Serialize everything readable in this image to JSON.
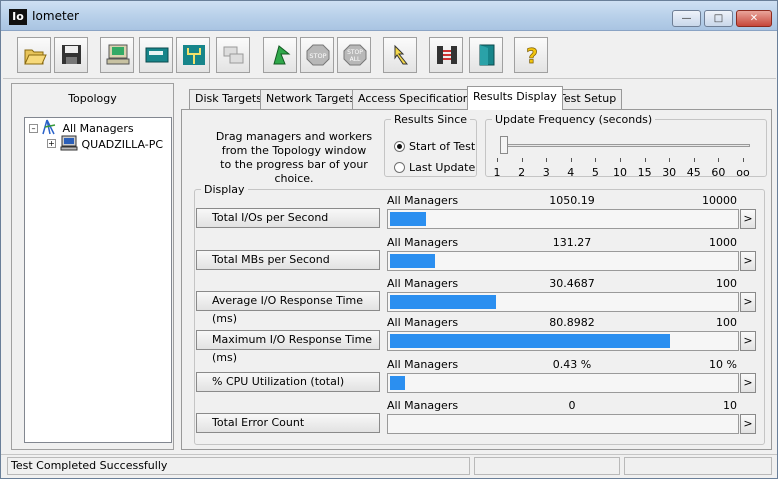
{
  "window": {
    "title": "Iometer",
    "app_icon_text": "Io"
  },
  "toolbar": {
    "buttons": [
      {
        "name": "open-config-icon"
      },
      {
        "name": "save-config-icon"
      },
      {
        "name": "new-manager-icon"
      },
      {
        "name": "new-disk-worker-icon"
      },
      {
        "name": "new-network-worker-icon"
      },
      {
        "name": "duplicate-worker-icon"
      },
      {
        "name": "start-tests-icon"
      },
      {
        "name": "stop-test-icon"
      },
      {
        "name": "stop-all-icon"
      },
      {
        "name": "reset-workers-icon"
      },
      {
        "name": "disconnect-workers-icon"
      },
      {
        "name": "exit-icon"
      },
      {
        "name": "about-icon"
      }
    ],
    "stop_label": "STOP",
    "stop_all_label": "STOP",
    "stop_all_sub": "ALL"
  },
  "topology": {
    "title": "Topology",
    "items": [
      {
        "label": "All Managers"
      },
      {
        "label": "QUADZILLA-PC"
      }
    ]
  },
  "tabs": [
    {
      "label": "Disk Targets",
      "active": false
    },
    {
      "label": "Network Targets",
      "active": false
    },
    {
      "label": "Access Specifications",
      "active": false
    },
    {
      "label": "Results Display",
      "active": true
    },
    {
      "label": "Test Setup",
      "active": false
    }
  ],
  "results": {
    "drag_text_1": "Drag managers and workers",
    "drag_text_2": "from the Topology window",
    "drag_text_3": "to the progress bar of your choice.",
    "since_title": "Results Since",
    "since_start": "Start of Test",
    "since_last": "Last Update",
    "since_selected": "start",
    "update_title": "Update Frequency (seconds)",
    "update_ticks": [
      "1",
      "2",
      "3",
      "4",
      "5",
      "10",
      "15",
      "30",
      "45",
      "60",
      "oo"
    ],
    "update_selected_index": 0,
    "display_title": "Display",
    "metrics": [
      {
        "button": "Total I/Os per Second",
        "source": "All Managers",
        "value": "1050.19",
        "max": "10000",
        "fraction": 0.105
      },
      {
        "button": "Total MBs per Second",
        "source": "All Managers",
        "value": "131.27",
        "max": "1000",
        "fraction": 0.131
      },
      {
        "button": "Average I/O Response Time (ms)",
        "source": "All Managers",
        "value": "30.4687",
        "max": "100",
        "fraction": 0.305
      },
      {
        "button": "Maximum I/O Response Time (ms)",
        "source": "All Managers",
        "value": "80.8982",
        "max": "100",
        "fraction": 0.809
      },
      {
        "button": "% CPU Utilization (total)",
        "source": "All Managers",
        "value": "0.43 %",
        "max": "10 %",
        "fraction": 0.043
      },
      {
        "button": "Total Error Count",
        "source": "All Managers",
        "value": "0",
        "max": "10",
        "fraction": 0
      }
    ],
    "arrow_label": ">"
  },
  "status": {
    "text": "Test Completed Successfully"
  },
  "colors": {
    "bar": "#2b8ff0"
  }
}
